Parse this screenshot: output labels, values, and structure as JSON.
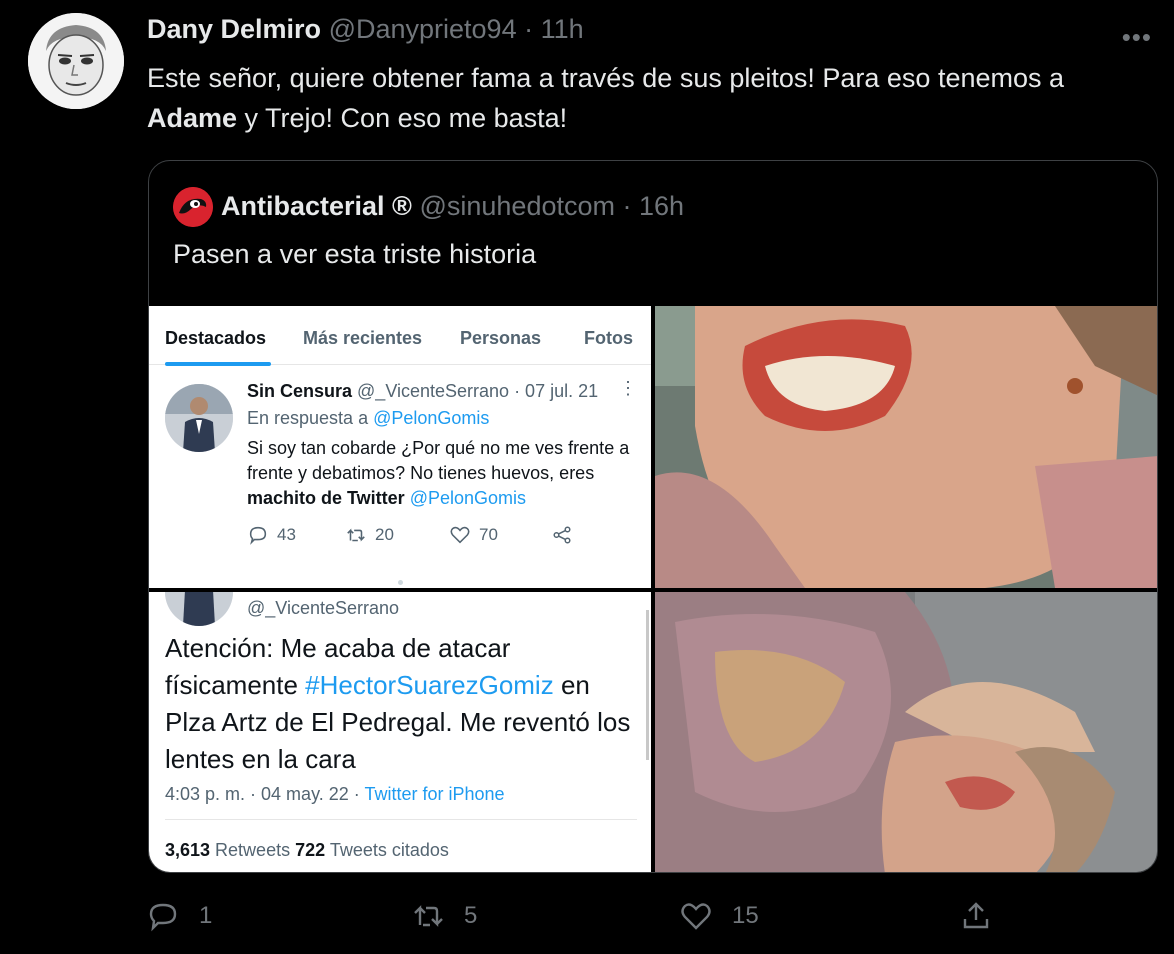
{
  "tweet": {
    "author_name": "Dany Delmiro",
    "handle": "@Danyprieto94",
    "separator": "·",
    "time": "11h",
    "more_label": "•••",
    "text_part1": "Este señor, quiere obtener fama a través de sus pleitos! Para eso tenemos a ",
    "text_bold": "Adame",
    "text_part2": " y Trejo! Con eso me basta!",
    "actions": {
      "reply_count": "1",
      "retweet_count": "5",
      "like_count": "15"
    }
  },
  "quoted": {
    "author_name": "Antibacterial ®",
    "handle": "@sinuhedotcom",
    "separator": "·",
    "time": "16h",
    "text": "Pasen a ver esta triste historia"
  },
  "screenshot1": {
    "tabs": [
      "Destacados",
      "Más recientes",
      "Personas",
      "Fotos"
    ],
    "name": "Sin Censura",
    "handle_time": " @_VicenteSerrano · 07 jul. 21",
    "dots": "⋮",
    "reply_prefix": "En respuesta a ",
    "reply_handle": "@PelonGomis",
    "text_line1": "Si soy tan cobarde ¿Por qué no me ves frente a frente y debatimos? No tienes huevos, eres ",
    "text_bold": "machito de Twitter",
    "text_link": " @PelonGomis",
    "reply_count": "43",
    "retweet_count": "20",
    "like_count": "70"
  },
  "screenshot2": {
    "handle": "@_VicenteSerrano",
    "text_part1": "Atención: Me acaba de atacar físicamente ",
    "text_hashtag": "#HectorSuarezGomiz",
    "text_part2": " en Plza Artz de El Pedregal. Me reventó los lentes en la cara",
    "meta_time": "4:03 p. m. · 04 may. 22 · ",
    "meta_source": "Twitter for iPhone",
    "retweets_count": "3,613",
    "retweets_label": " Retweets  ",
    "quotes_count": "722",
    "quotes_label": " Tweets citados"
  },
  "colors": {
    "background": "#000000",
    "text": "#e7e9ea",
    "muted": "#71767b",
    "link": "#1d9bf0",
    "border": "#3e4144"
  }
}
